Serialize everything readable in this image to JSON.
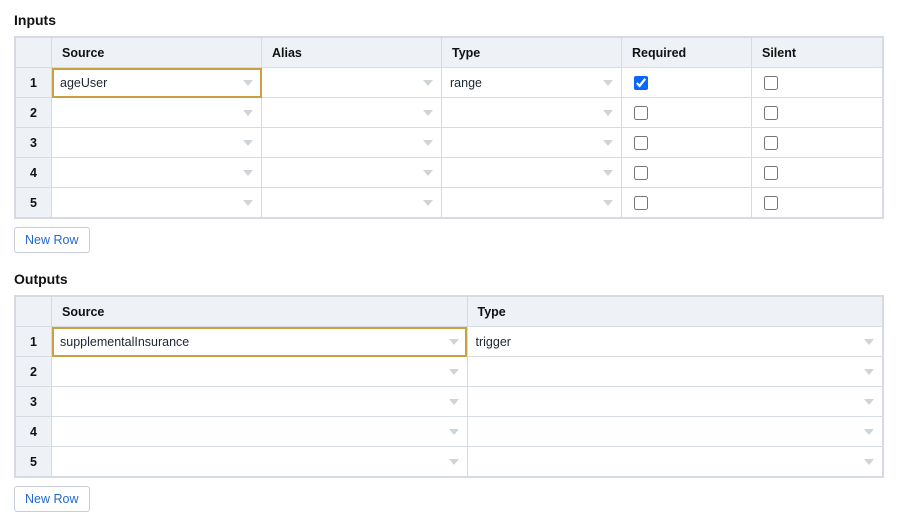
{
  "inputs": {
    "title": "Inputs",
    "headers": {
      "source": "Source",
      "alias": "Alias",
      "type": "Type",
      "required": "Required",
      "silent": "Silent"
    },
    "rows": [
      {
        "n": "1",
        "source": "ageUser",
        "alias": "",
        "type": "range",
        "required": true,
        "silent": false,
        "selected": true
      },
      {
        "n": "2",
        "source": "",
        "alias": "",
        "type": "",
        "required": false,
        "silent": false,
        "selected": false
      },
      {
        "n": "3",
        "source": "",
        "alias": "",
        "type": "",
        "required": false,
        "silent": false,
        "selected": false
      },
      {
        "n": "4",
        "source": "",
        "alias": "",
        "type": "",
        "required": false,
        "silent": false,
        "selected": false
      },
      {
        "n": "5",
        "source": "",
        "alias": "",
        "type": "",
        "required": false,
        "silent": false,
        "selected": false
      }
    ],
    "new_row_label": "New Row"
  },
  "outputs": {
    "title": "Outputs",
    "headers": {
      "source": "Source",
      "type": "Type"
    },
    "rows": [
      {
        "n": "1",
        "source": "supplementalInsurance",
        "type": "trigger",
        "selected": true
      },
      {
        "n": "2",
        "source": "",
        "type": "",
        "selected": false
      },
      {
        "n": "3",
        "source": "",
        "type": "",
        "selected": false
      },
      {
        "n": "4",
        "source": "",
        "type": "",
        "selected": false
      },
      {
        "n": "5",
        "source": "",
        "type": "",
        "selected": false
      }
    ],
    "new_row_label": "New Row"
  }
}
